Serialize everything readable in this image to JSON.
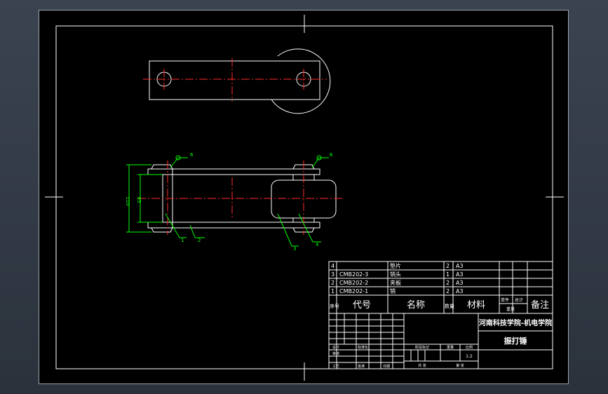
{
  "bom": {
    "rows": [
      {
        "index": "4",
        "code": "",
        "name": "垫片",
        "qty": "2",
        "material": "A3"
      },
      {
        "index": "3",
        "code": "CMB202-3",
        "name": "销头",
        "qty": "1",
        "material": "A3"
      },
      {
        "index": "2",
        "code": "CMB202-2",
        "name": "夹板",
        "qty": "2",
        "material": "A3"
      },
      {
        "index": "1",
        "code": "CMB202-1",
        "name": "销",
        "qty": "2",
        "material": "A3"
      }
    ],
    "header": {
      "index": "序号",
      "code": "代号",
      "name": "名称",
      "qty": "数量",
      "material": "材料",
      "single": "单件",
      "total": "总计",
      "weight": "重量",
      "remark": "备注"
    }
  },
  "title_block": {
    "school": "河南科技学院-机电学院",
    "drawing_name": "振打锤",
    "scale": "1:2",
    "labels": {
      "design": "设计",
      "review": "审核",
      "process": "工艺",
      "standardize": "标准化",
      "approve": "批准",
      "date": "日期",
      "stage": "阶段标记",
      "weight": "重量",
      "ratio": "比例",
      "total_sheets": "共   张",
      "sheet": "第   张"
    }
  },
  "dimensions": {
    "outer_height": "110",
    "inner_height": "85"
  },
  "balloons": {
    "b1": "1",
    "b2": "2",
    "b3": "3",
    "b4": "4",
    "weld_left": "6",
    "weld_right": "6"
  }
}
